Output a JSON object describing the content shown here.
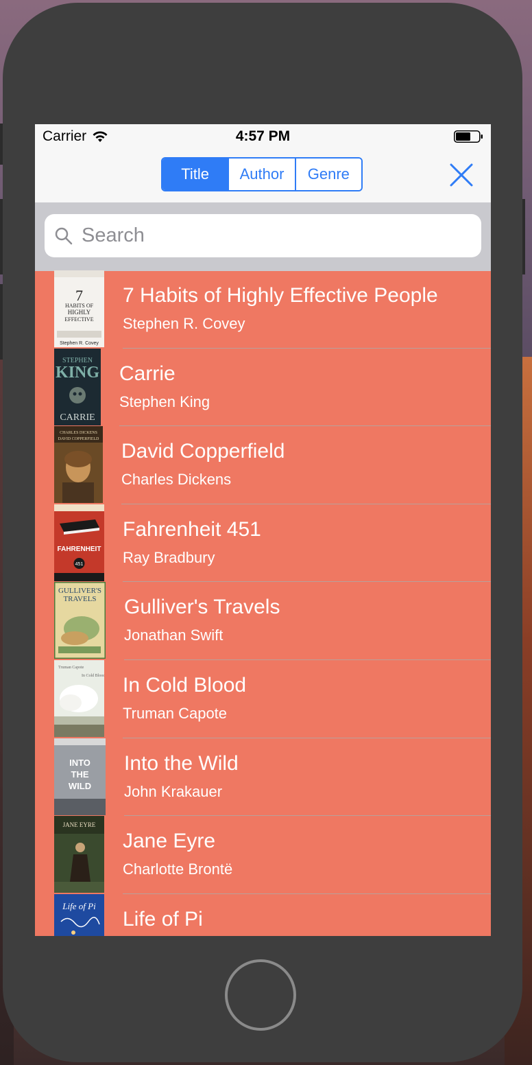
{
  "status_bar": {
    "carrier": "Carrier",
    "time": "4:57 PM"
  },
  "segmented_control": {
    "segments": [
      "Title",
      "Author",
      "Genre"
    ],
    "selected": "Title"
  },
  "search": {
    "placeholder": "Search"
  },
  "books": [
    {
      "title": "7 Habits of Highly Effective People",
      "author": "Stephen R. Covey",
      "cover_icon": "book-cover-7-habits"
    },
    {
      "title": "Carrie",
      "author": "Stephen King",
      "cover_icon": "book-cover-carrie"
    },
    {
      "title": "David Copperfield",
      "author": "Charles Dickens",
      "cover_icon": "book-cover-david-copperfield"
    },
    {
      "title": "Fahrenheit 451",
      "author": "Ray Bradbury",
      "cover_icon": "book-cover-fahrenheit-451"
    },
    {
      "title": "Gulliver's Travels",
      "author": "Jonathan Swift",
      "cover_icon": "book-cover-gullivers-travels"
    },
    {
      "title": "In Cold Blood",
      "author": "Truman Capote",
      "cover_icon": "book-cover-in-cold-blood"
    },
    {
      "title": "Into the Wild",
      "author": "John Krakauer",
      "cover_icon": "book-cover-into-the-wild"
    },
    {
      "title": "Jane Eyre",
      "author": "Charlotte Brontë",
      "cover_icon": "book-cover-jane-eyre"
    },
    {
      "title": "Life of Pi",
      "author": "",
      "cover_icon": "book-cover-life-of-pi"
    }
  ],
  "colors": {
    "accent": "#2f7cf6",
    "list_background": "#ef7862",
    "device_frame": "#3e3e3e"
  }
}
